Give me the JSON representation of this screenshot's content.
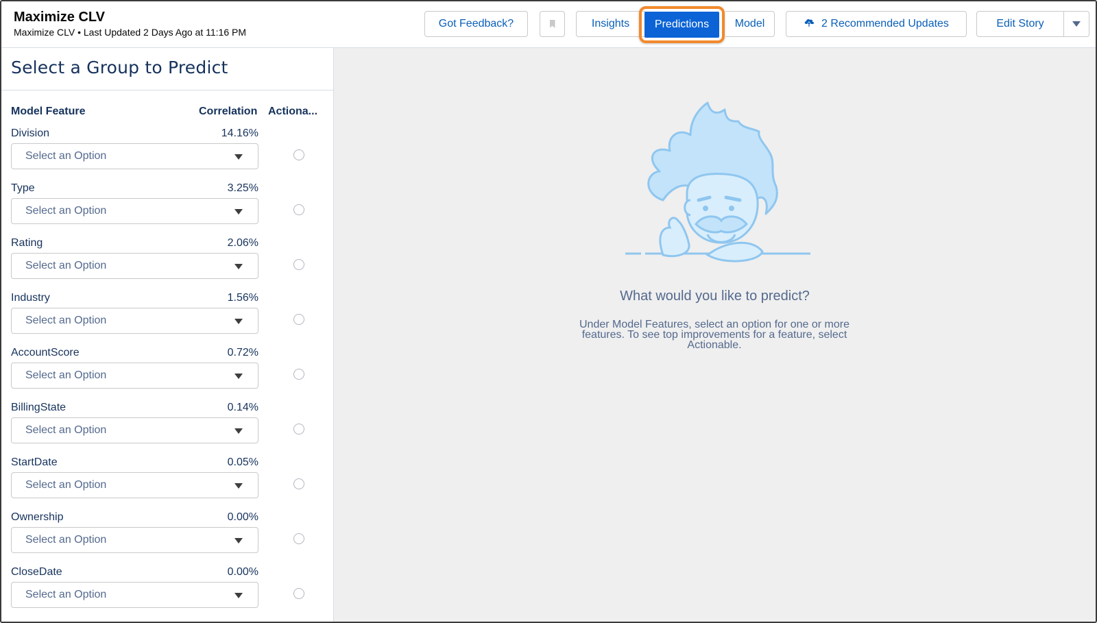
{
  "header": {
    "title": "Maximize CLV",
    "subtitle": "Maximize CLV • Last Updated 2 Days Ago at 11:16 PM",
    "feedback_label": "Got Feedback?",
    "tabs": [
      {
        "label": "Insights",
        "selected": false
      },
      {
        "label": "Predictions",
        "selected": true
      },
      {
        "label": "Model",
        "selected": false
      }
    ],
    "updates_label": "2 Recommended Updates",
    "edit_label": "Edit Story"
  },
  "panel": {
    "title": "Select a Group to Predict",
    "columns": {
      "feature": "Model Feature",
      "correlation": "Correlation",
      "actionable": "Actiona..."
    },
    "features": [
      {
        "name": "Division",
        "correlation": "14.16%",
        "placeholder": "Select an Option"
      },
      {
        "name": "Type",
        "correlation": "3.25%",
        "placeholder": "Select an Option"
      },
      {
        "name": "Rating",
        "correlation": "2.06%",
        "placeholder": "Select an Option"
      },
      {
        "name": "Industry",
        "correlation": "1.56%",
        "placeholder": "Select an Option"
      },
      {
        "name": "AccountScore",
        "correlation": "0.72%",
        "placeholder": "Select an Option"
      },
      {
        "name": "BillingState",
        "correlation": "0.14%",
        "placeholder": "Select an Option"
      },
      {
        "name": "StartDate",
        "correlation": "0.05%",
        "placeholder": "Select an Option"
      },
      {
        "name": "Ownership",
        "correlation": "0.00%",
        "placeholder": "Select an Option"
      },
      {
        "name": "CloseDate",
        "correlation": "0.00%",
        "placeholder": "Select an Option"
      }
    ]
  },
  "empty_state": {
    "title": "What would you like to predict?",
    "message": "Under Model Features, select an option for one or more features. To see top improvements for a feature, select Actionable."
  },
  "colors": {
    "accent": "#0b63d6",
    "highlight": "#f28a2c",
    "illustration": "#a9d6f5"
  },
  "icons": {
    "updates": "upload-cloud-icon",
    "bookmark": "bookmark-icon",
    "caret": "chevron-down-icon"
  }
}
